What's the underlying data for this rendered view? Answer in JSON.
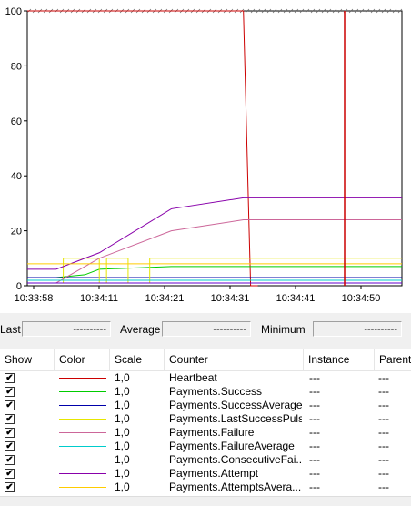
{
  "chart_data": {
    "type": "line",
    "y_ticks": [
      "100",
      "80",
      "60",
      "40",
      "20",
      "0"
    ],
    "ylim": [
      0,
      100
    ],
    "x_ticks": [
      "10:33:58",
      "10:34:11",
      "10:34:21",
      "10:34:31",
      "10:34:41",
      "10:34:50"
    ],
    "series": [
      {
        "name": "Heartbeat",
        "color": "#cc0000",
        "x": [
          0,
          30,
          31,
          32
        ],
        "values": [
          100,
          100,
          0,
          0
        ]
      },
      {
        "name": "Payments.Success",
        "color": "#00cc00",
        "x": [
          0,
          4,
          8,
          10,
          20,
          50,
          52
        ],
        "values": [
          3,
          3,
          4,
          6,
          7,
          7,
          7
        ]
      },
      {
        "name": "Payments.SuccessAverage",
        "color": "#0000aa",
        "x": [
          0,
          52
        ],
        "values": [
          3,
          3
        ]
      },
      {
        "name": "Payments.LastSuccessPulse",
        "color": "#e6e600",
        "x": [
          0,
          5,
          5,
          10,
          10,
          11,
          11,
          14,
          14,
          17,
          17,
          21,
          21,
          52
        ],
        "values": [
          1,
          1,
          10,
          10,
          1,
          1,
          10,
          10,
          1,
          1,
          10,
          10,
          10,
          10
        ]
      },
      {
        "name": "Payments.Failure",
        "color": "#cc6699",
        "x": [
          0,
          4,
          10,
          20,
          30,
          52
        ],
        "values": [
          1,
          1,
          10,
          20,
          24,
          24
        ]
      },
      {
        "name": "Payments.FailureAverage",
        "color": "#00cccc",
        "x": [
          0,
          52
        ],
        "values": [
          2,
          2
        ]
      },
      {
        "name": "Payments.ConsecutiveFailure",
        "color": "#6600cc",
        "x": [
          0,
          52
        ],
        "values": [
          1,
          1
        ]
      },
      {
        "name": "Payments.Attempt",
        "color": "#8800aa",
        "x": [
          0,
          4,
          10,
          20,
          30,
          52
        ],
        "values": [
          6,
          6,
          12,
          28,
          32,
          32
        ]
      },
      {
        "name": "Payments.AttemptsAverage",
        "color": "#ffcc00",
        "x": [
          0,
          52
        ],
        "values": [
          8,
          8
        ]
      }
    ]
  },
  "stats": {
    "last_label": "Last",
    "last_value": "----------",
    "average_label": "Average",
    "average_value": "----------",
    "minimum_label": "Minimum",
    "minimum_value": "----------"
  },
  "table": {
    "headers": [
      "Show",
      "Color",
      "Scale",
      "Counter",
      "Instance",
      "Parent"
    ],
    "rows": [
      {
        "show": "✔",
        "color": "#cc0000",
        "scale": "1,0",
        "counter": "Heartbeat",
        "instance": "---",
        "parent": "---"
      },
      {
        "show": "✔",
        "color": "#00cc00",
        "scale": "1,0",
        "counter": "Payments.Success",
        "instance": "---",
        "parent": "---"
      },
      {
        "show": "✔",
        "color": "#0000aa",
        "scale": "1,0",
        "counter": "Payments.SuccessAverage",
        "instance": "---",
        "parent": "---"
      },
      {
        "show": "✔",
        "color": "#e6e600",
        "scale": "1,0",
        "counter": "Payments.LastSuccessPulse",
        "instance": "---",
        "parent": "---"
      },
      {
        "show": "✔",
        "color": "#cc6699",
        "scale": "1,0",
        "counter": "Payments.Failure",
        "instance": "---",
        "parent": "---"
      },
      {
        "show": "✔",
        "color": "#00cccc",
        "scale": "1,0",
        "counter": "Payments.FailureAverage",
        "instance": "---",
        "parent": "---"
      },
      {
        "show": "✔",
        "color": "#6600cc",
        "scale": "1,0",
        "counter": "Payments.ConsecutiveFai...",
        "instance": "---",
        "parent": "---"
      },
      {
        "show": "✔",
        "color": "#8800aa",
        "scale": "1,0",
        "counter": "Payments.Attempt",
        "instance": "---",
        "parent": "---"
      },
      {
        "show": "✔",
        "color": "#ffcc00",
        "scale": "1,0",
        "counter": "Payments.AttemptsAvera...",
        "instance": "---",
        "parent": "---"
      }
    ]
  }
}
